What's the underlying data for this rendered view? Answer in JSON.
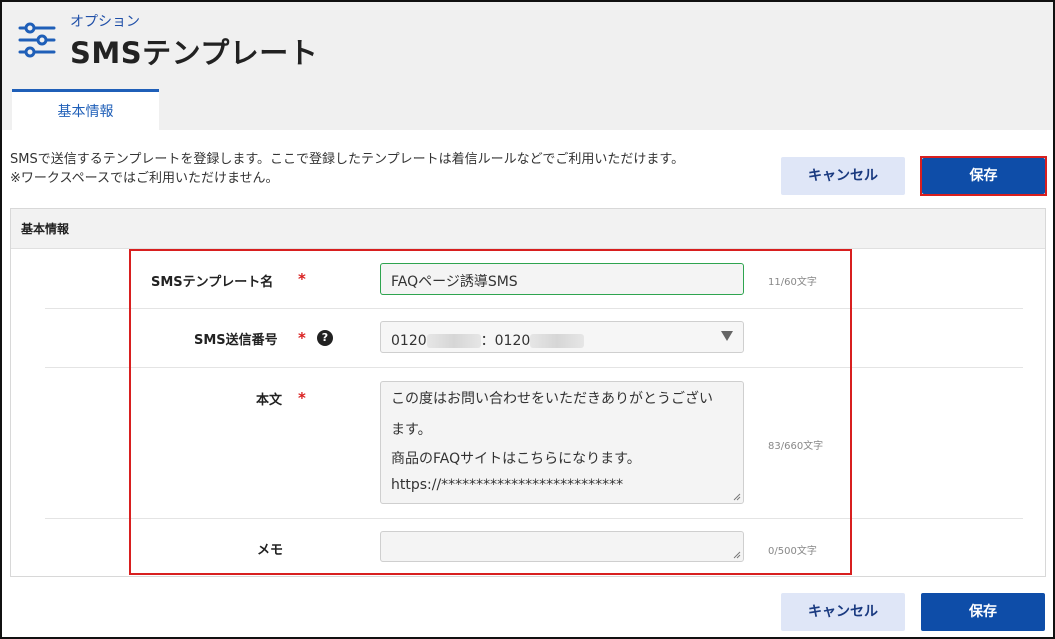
{
  "header": {
    "breadcrumb": "オプション",
    "title": "SMSテンプレート",
    "icon": "sliders-icon"
  },
  "tabs": [
    {
      "label": "基本情報",
      "active": true
    }
  ],
  "description": {
    "line1": "SMSで送信するテンプレートを登録します。ここで登録したテンプレートは着信ルールなどでご利用いただけます。",
    "line2": "※ワークスペースではご利用いただけません。"
  },
  "actions": {
    "cancel_label": "キャンセル",
    "save_label": "保存"
  },
  "panel": {
    "title": "基本情報",
    "fields": {
      "template_name": {
        "label": "SMSテンプレート名",
        "required_mark": "*",
        "value": "FAQページ誘導SMS",
        "counter": "11/60文字"
      },
      "sender_number": {
        "label": "SMS送信番号",
        "required_mark": "*",
        "help": "?",
        "value_prefix": "0120",
        "value_sep": "：0120"
      },
      "body": {
        "label": "本文",
        "required_mark": "*",
        "lines": [
          "この度はお問い合わせをいただきありがとうござい",
          "ます。",
          "商品のFAQサイトはこちらになります。",
          "https://**************************"
        ],
        "counter": "83/660文字"
      },
      "memo": {
        "label": "メモ",
        "value": "",
        "counter": "0/500文字"
      }
    }
  },
  "colors": {
    "accent": "#1f5fb8",
    "primary_button": "#0e4da8",
    "cancel_button": "#dfe6f7",
    "required": "#d81f1f",
    "highlight_outline": "#d81f1f",
    "focus_border": "#2ea44f"
  }
}
